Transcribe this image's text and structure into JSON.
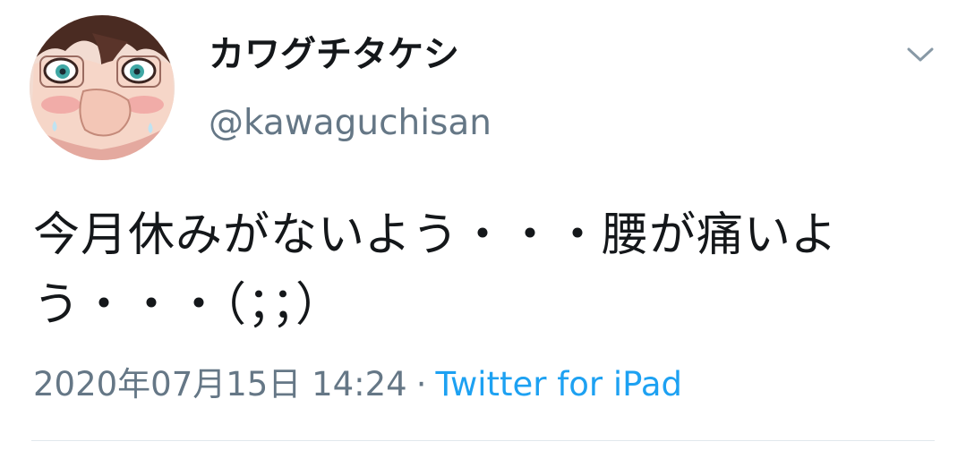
{
  "tweet": {
    "display_name": "カワグチタケシ",
    "handle": "@kawaguchisan",
    "text": "今月休みがないよう・・・腰が痛いよう・・・（；；）",
    "timestamp": "2020年07月15日 14:24",
    "separator": "·",
    "source": "Twitter for iPad",
    "menu_icon": "chevron-down-icon"
  },
  "colors": {
    "text_primary": "#14171a",
    "text_secondary": "#657786",
    "link": "#1da1f2",
    "divider": "#e1e8ed"
  }
}
